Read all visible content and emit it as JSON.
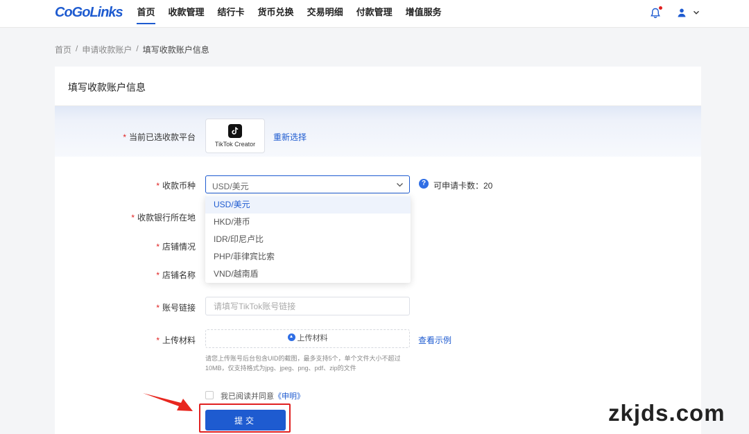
{
  "brand": {
    "logo_text": "CoGoLinks",
    "accent": "#1e5bd0",
    "alert_red": "#e02020"
  },
  "nav": {
    "items": [
      {
        "label": "首页",
        "active": true
      },
      {
        "label": "收款管理"
      },
      {
        "label": "结行卡"
      },
      {
        "label": "货币兑换"
      },
      {
        "label": "交易明细"
      },
      {
        "label": "付款管理"
      },
      {
        "label": "增值服务"
      }
    ],
    "icons": [
      "bell-icon",
      "user-icon",
      "chevron-down-icon"
    ]
  },
  "breadcrumb": {
    "home": "首页",
    "sep": "/",
    "parent": "申请收款账户",
    "current": "填写收款账户信息"
  },
  "card": {
    "title": "填写收款账户信息"
  },
  "form": {
    "platform_label": "当前已选收款平台",
    "platform_name": "TikTok Creator",
    "platform_icon": "tiktok-icon",
    "reselect": "重新选择",
    "currency_label": "收款币种",
    "currency_value": "USD/美元",
    "available_text": "可申请卡数：20",
    "bank_label": "收款银行所在地",
    "shop_status_label": "店铺情况",
    "shop_name_label": "店铺名称",
    "account_link_label": "账号链接",
    "account_link_placeholder": "请填写TikTok账号链接",
    "upload_label": "上传材料",
    "upload_button": "上传材料",
    "view_example": "查看示例",
    "upload_hint": "请您上传账号后台包含UID的截图，最多支持5个，单个文件大小不超过10MB，仅支持格式为jpg、jpeg、png、pdf、zip的文件",
    "agree_text": "我已阅读并同意",
    "agree_link": "《申明》",
    "submit": "提交"
  },
  "currency_options": [
    "USD/美元",
    "HKD/港币",
    "IDR/印尼卢比",
    "PHP/菲律宾比索",
    "VND/越南盾"
  ],
  "selected_option": "USD/美元",
  "watermark": "zkjds.com"
}
